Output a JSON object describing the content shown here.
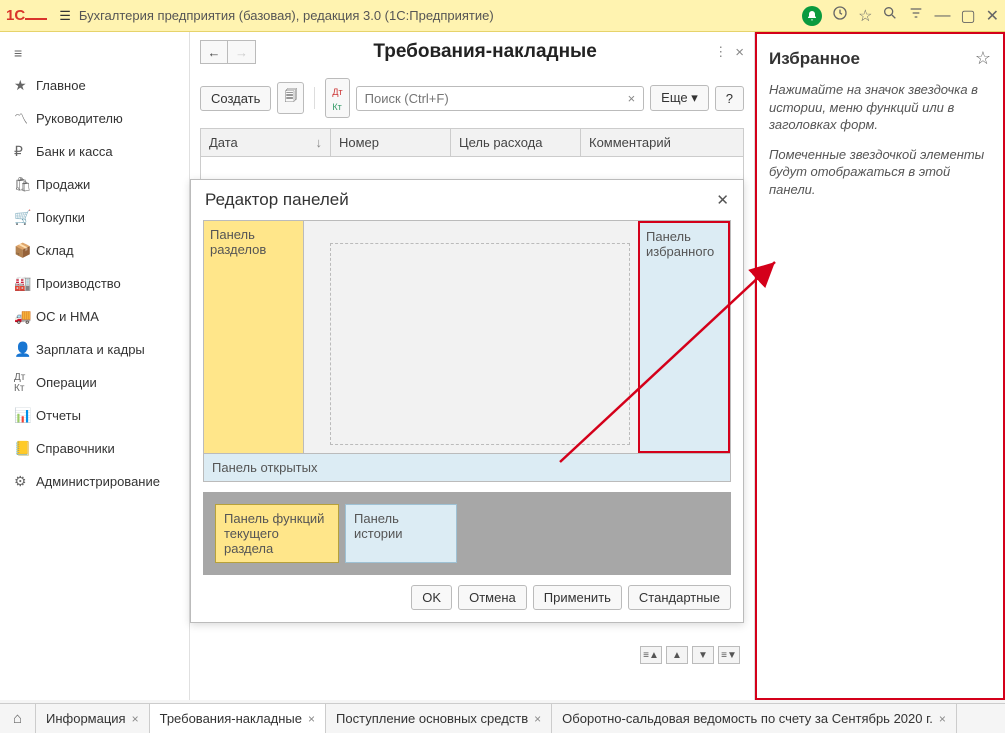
{
  "app": {
    "title": "Бухгалтерия предприятия (базовая), редакция 3.0  (1С:Предприятие)"
  },
  "sidebar": {
    "items": [
      {
        "label": "Главное"
      },
      {
        "label": "Руководителю"
      },
      {
        "label": "Банк и касса"
      },
      {
        "label": "Продажи"
      },
      {
        "label": "Покупки"
      },
      {
        "label": "Склад"
      },
      {
        "label": "Производство"
      },
      {
        "label": "ОС и НМА"
      },
      {
        "label": "Зарплата и кадры"
      },
      {
        "label": "Операции"
      },
      {
        "label": "Отчеты"
      },
      {
        "label": "Справочники"
      },
      {
        "label": "Администрирование"
      }
    ]
  },
  "doc": {
    "title": "Требования-накладные",
    "create": "Создать",
    "search_placeholder": "Поиск (Ctrl+F)",
    "more": "Еще",
    "help": "?",
    "cols": {
      "date": "Дата",
      "num": "Номер",
      "purpose": "Цель расхода",
      "comment": "Комментарий"
    },
    "sort_indicator": "↓"
  },
  "panel_editor": {
    "title": "Редактор панелей",
    "sections": "Панель разделов",
    "fav": "Панель избранного",
    "open": "Панель открытых",
    "func": "Панель функций текущего раздела",
    "history": "Панель истории",
    "ok": "OK",
    "cancel": "Отмена",
    "apply": "Применить",
    "standard": "Стандартные"
  },
  "favorites": {
    "title": "Избранное",
    "p1": "Нажимайте на значок звездочка в истории, меню функций или в заголовках форм.",
    "p2": "Помеченные звездочкой элементы будут отображаться в этой панели."
  },
  "tabs": [
    {
      "label": "Информация"
    },
    {
      "label": "Требования-накладные"
    },
    {
      "label": "Поступление основных средств"
    },
    {
      "label": "Оборотно-сальдовая ведомость по счету  за Сентябрь 2020 г."
    }
  ]
}
